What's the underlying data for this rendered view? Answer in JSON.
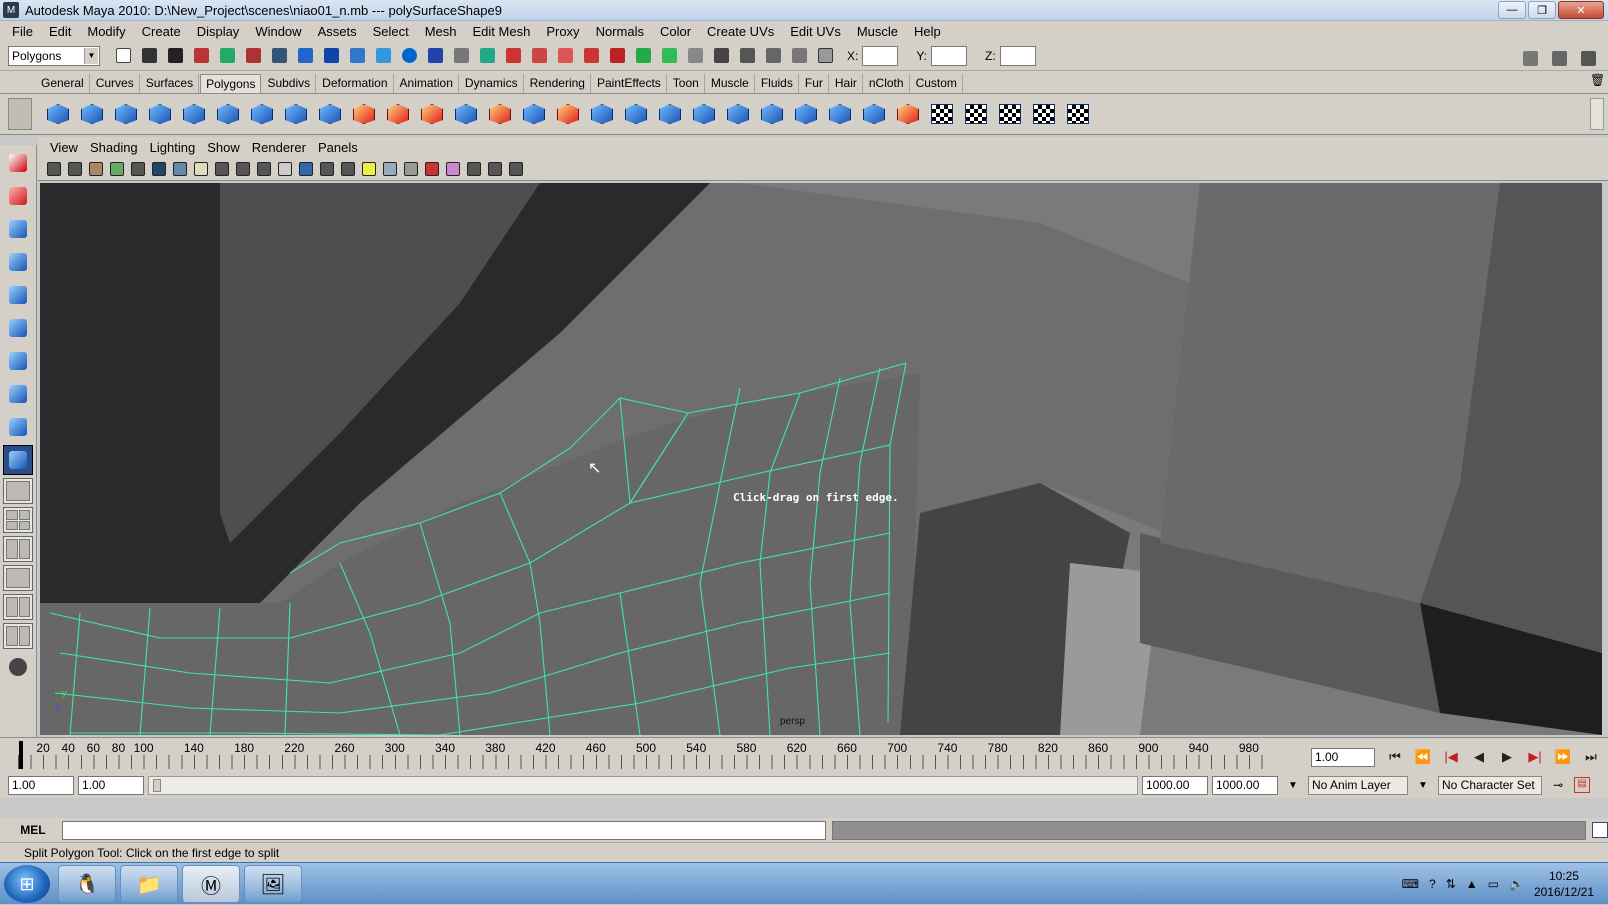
{
  "window": {
    "title": "Autodesk Maya 2010: D:\\New_Project\\scenes\\niao01_n.mb  ---  polySurfaceShape9",
    "minimize": "—",
    "maximize": "❐",
    "close": "✕"
  },
  "menu": [
    "File",
    "Edit",
    "Modify",
    "Create",
    "Display",
    "Window",
    "Assets",
    "Select",
    "Mesh",
    "Edit Mesh",
    "Proxy",
    "Normals",
    "Color",
    "Create UVs",
    "Edit UVs",
    "Muscle",
    "Help"
  ],
  "status_line": {
    "mode": "Polygons",
    "x_label": "X:",
    "y_label": "Y:",
    "z_label": "Z:",
    "x_value": "",
    "y_value": "",
    "z_value": ""
  },
  "shelf_tabs": [
    "General",
    "Curves",
    "Surfaces",
    "Polygons",
    "Subdivs",
    "Deformation",
    "Animation",
    "Dynamics",
    "Rendering",
    "PaintEffects",
    "Toon",
    "Muscle",
    "Fluids",
    "Fur",
    "Hair",
    "nCloth",
    "Custom"
  ],
  "active_shelf_tab": "Polygons",
  "panel_menu": [
    "View",
    "Shading",
    "Lighting",
    "Show",
    "Renderer",
    "Panels"
  ],
  "viewport": {
    "hint": "Click-drag on first edge.",
    "camera": "persp",
    "axis_y": "y",
    "axis_z": "z",
    "cursor": "↖"
  },
  "timeline": {
    "labels": [
      "20",
      "40",
      "60",
      "80",
      "100",
      "140",
      "180",
      "220",
      "260",
      "300",
      "340",
      "380",
      "420",
      "460",
      "500",
      "540",
      "580",
      "620",
      "660",
      "700",
      "740",
      "780",
      "820",
      "860",
      "900",
      "940",
      "980"
    ],
    "current_time": "1.00",
    "current_frame": 1,
    "playback": [
      "⏮",
      "⏪",
      "|◀",
      "◀",
      "▶",
      "▶|",
      "⏩",
      "⏭"
    ]
  },
  "range": {
    "start": "1.00",
    "playback_start": "1.00",
    "playback_end": "1000.00",
    "end": "1000.00",
    "anim_layer": "No Anim Layer",
    "character_set": "No Character Set"
  },
  "command_line": {
    "label": "MEL",
    "value": ""
  },
  "help_line": "Split Polygon Tool: Click on the first edge to split",
  "taskbar": {
    "start": "⊞",
    "clock_time": "10:25",
    "clock_date": "2016/12/21"
  }
}
